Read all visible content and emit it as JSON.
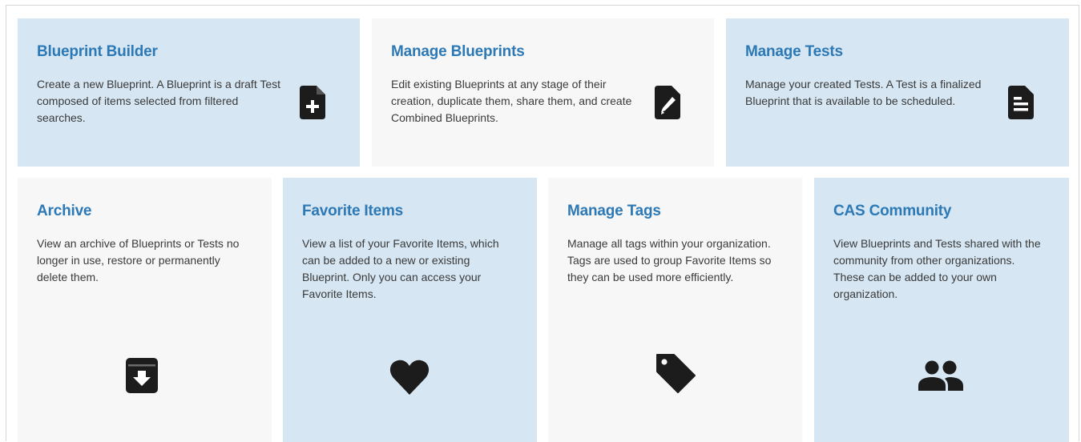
{
  "cards": [
    {
      "title": "Blueprint Builder",
      "description": "Create a new Blueprint. A Blueprint is a draft Test composed of items selected from filtered searches.",
      "icon": "file-plus-icon",
      "theme": "blue"
    },
    {
      "title": "Manage Blueprints",
      "description": "Edit existing Blueprints at any stage of their creation, duplicate them, share them, and create Combined Blueprints.",
      "icon": "file-edit-icon",
      "theme": "gray"
    },
    {
      "title": "Manage Tests",
      "description": "Manage your created Tests. A Test is a finalized Blueprint that is available to be scheduled.",
      "icon": "file-text-icon",
      "theme": "blue"
    },
    {
      "title": "Archive",
      "description": "View an archive of Blueprints or Tests no longer in use, restore or permanently delete them.",
      "icon": "archive-box-icon",
      "theme": "gray"
    },
    {
      "title": "Favorite Items",
      "description": "View a list of your Favorite Items, which can be added to a new or existing Blueprint. Only you can access your Favorite Items.",
      "icon": "heart-icon",
      "theme": "blue"
    },
    {
      "title": "Manage Tags",
      "description": "Manage all tags within your organization. Tags are used to group Favorite Items so they can be used more efficiently.",
      "icon": "tag-icon",
      "theme": "gray"
    },
    {
      "title": "CAS Community",
      "description": "View Blueprints and Tests shared with the community from other organizations. These can be added to your own organization.",
      "icon": "people-group-icon",
      "theme": "blue"
    }
  ],
  "colors": {
    "card_blue": "#d6e6f2",
    "card_gray": "#f7f7f7",
    "title": "#2c79b5",
    "text": "#3a3a3a",
    "icon": "#1c1c1c"
  }
}
